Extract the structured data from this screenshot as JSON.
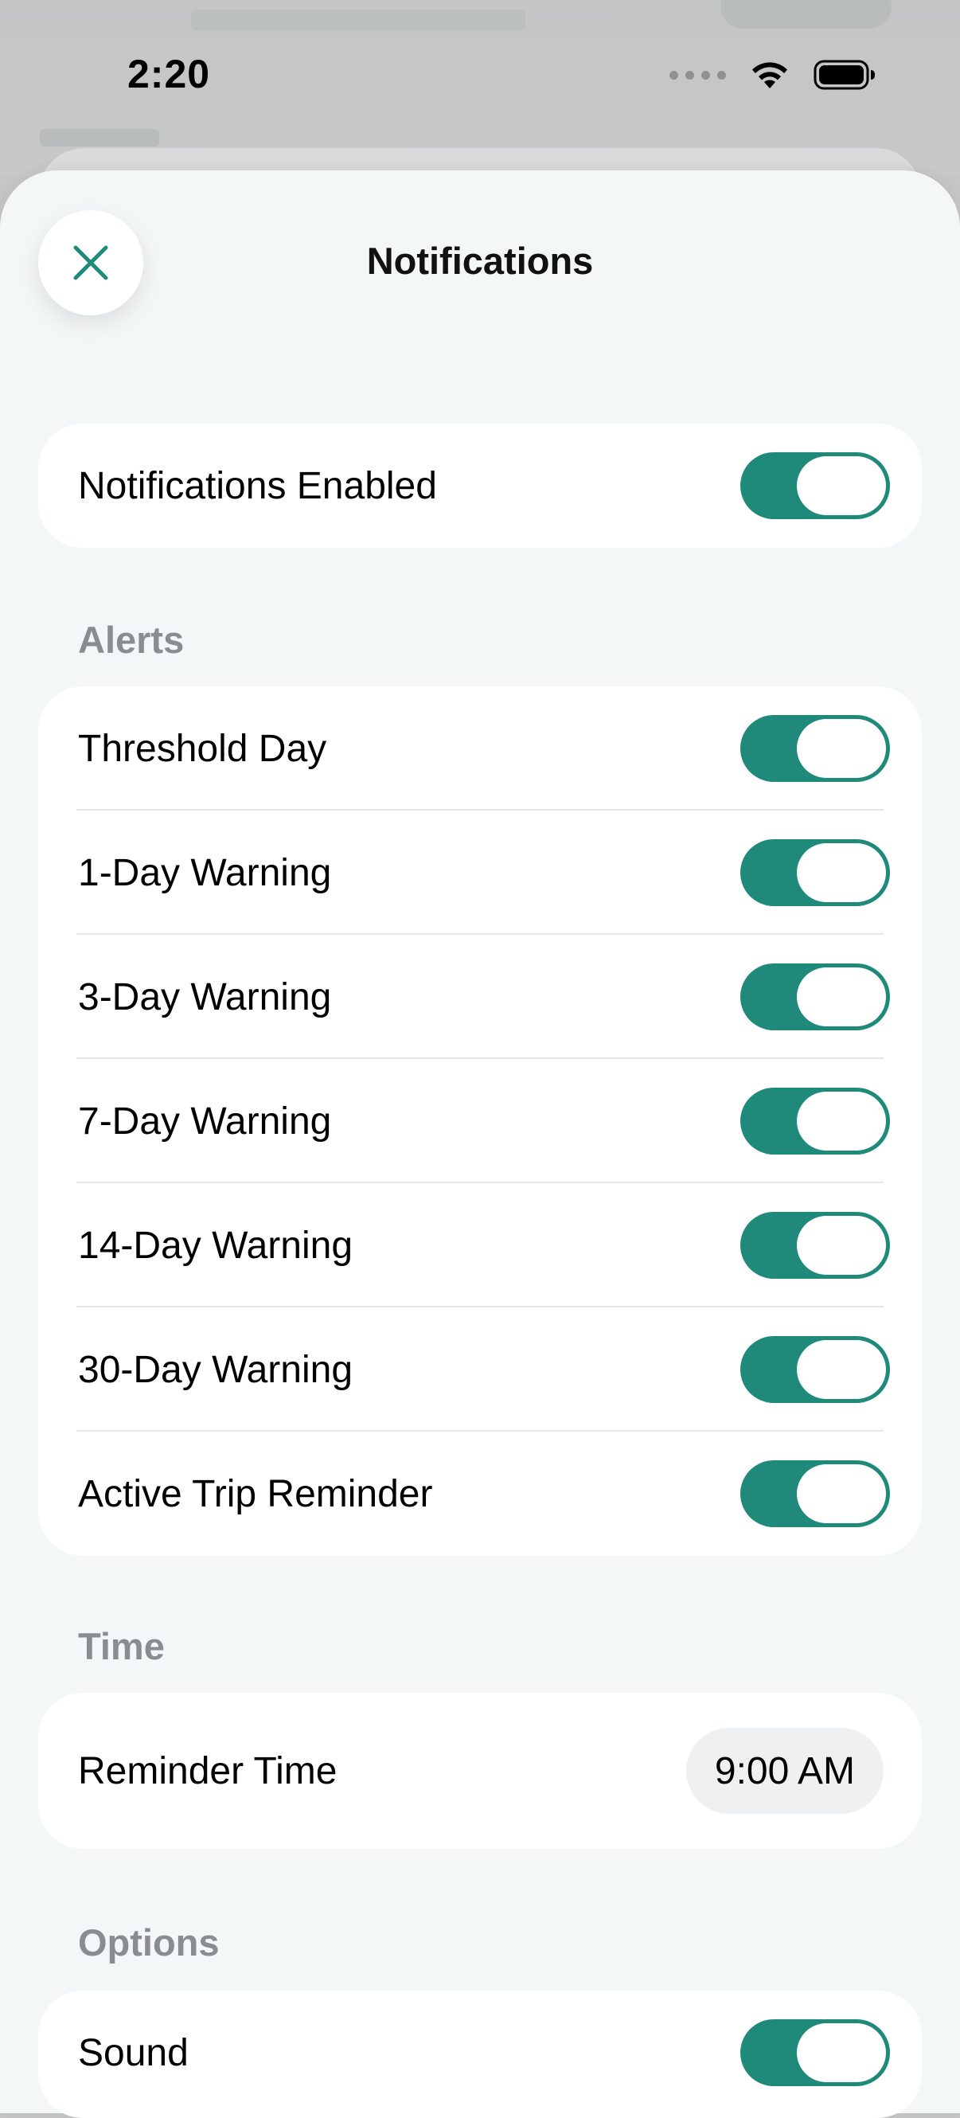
{
  "status_bar": {
    "time": "2:20",
    "icons": [
      "signal-dots-icon",
      "wifi-icon",
      "battery-icon"
    ]
  },
  "sheet": {
    "title": "Notifications",
    "close_icon": "close-icon"
  },
  "colors": {
    "accent": "#1f8a7a",
    "sheet_background": "#f4f7f8",
    "card_background": "#ffffff",
    "section_label": "#8a8d90"
  },
  "master": {
    "label": "Notifications Enabled",
    "enabled": true
  },
  "alerts": {
    "section_label": "Alerts",
    "items": [
      {
        "label": "Threshold Day",
        "enabled": true
      },
      {
        "label": "1-Day Warning",
        "enabled": true
      },
      {
        "label": "3-Day Warning",
        "enabled": true
      },
      {
        "label": "7-Day Warning",
        "enabled": true
      },
      {
        "label": "14-Day Warning",
        "enabled": true
      },
      {
        "label": "30-Day Warning",
        "enabled": true
      },
      {
        "label": "Active Trip Reminder",
        "enabled": true
      }
    ]
  },
  "time": {
    "section_label": "Time",
    "reminder_label": "Reminder Time",
    "reminder_value": "9:00 AM"
  },
  "options": {
    "section_label": "Options",
    "items": [
      {
        "label": "Sound",
        "enabled": true
      }
    ]
  }
}
